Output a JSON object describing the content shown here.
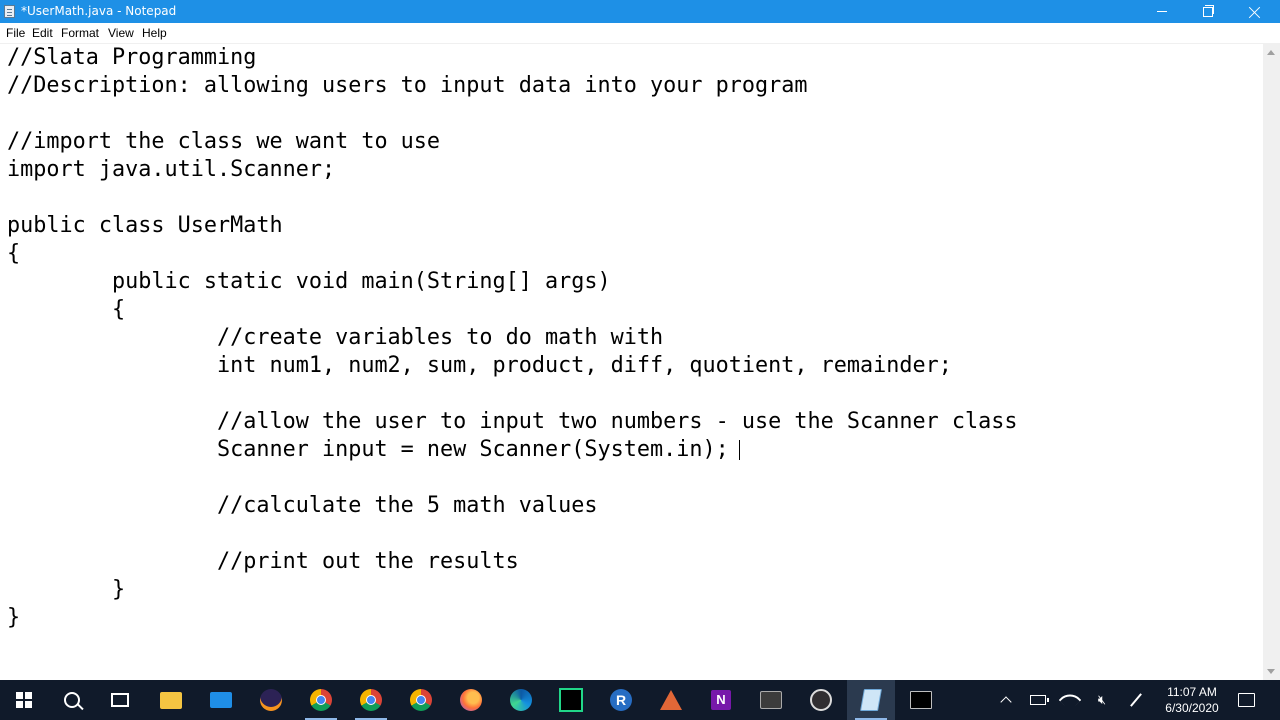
{
  "window": {
    "title": "*UserMath.java - Notepad"
  },
  "menu": [
    "File",
    "Edit",
    "Format",
    "View",
    "Help"
  ],
  "editor": {
    "lines": [
      "//Slata Programming",
      "//Description: allowing users to input data into your program",
      "",
      "//import the class we want to use",
      "import java.util.Scanner;",
      "",
      "public class UserMath",
      "{",
      "        public static void main(String[] args)",
      "        {",
      "                //create variables to do math with",
      "                int num1, num2, sum, product, diff, quotient, remainder;",
      "",
      "                //allow the user to input two numbers - use the Scanner class",
      "                Scanner input = new Scanner(System.in);",
      "",
      "                //calculate the 5 math values",
      "",
      "                //print out the results",
      "        }",
      "}"
    ]
  },
  "taskbar": {
    "apps": [
      {
        "icon": "windows-start-icon"
      },
      {
        "icon": "search-icon"
      },
      {
        "icon": "task-view-icon"
      },
      {
        "icon": "file-explorer-icon"
      },
      {
        "icon": "mail-icon"
      },
      {
        "icon": "eclipse-icon"
      },
      {
        "icon": "chrome-icon"
      },
      {
        "icon": "chrome-icon"
      },
      {
        "icon": "chrome-icon"
      },
      {
        "icon": "firefox-icon"
      },
      {
        "icon": "edge-icon"
      },
      {
        "icon": "pycharm-icon"
      },
      {
        "icon": "r-icon",
        "label": "R"
      },
      {
        "icon": "matlab-icon"
      },
      {
        "icon": "onenote-icon",
        "label": "N"
      },
      {
        "icon": "terminal-icon"
      },
      {
        "icon": "obs-icon"
      },
      {
        "icon": "notepad-icon"
      },
      {
        "icon": "cmd-icon"
      }
    ],
    "clock": {
      "time": "11:07 AM",
      "date": "6/30/2020"
    }
  },
  "colors": {
    "titlebar": "#1e90e6",
    "taskbar": "#101a2a",
    "editor_bg": "#ffffff"
  }
}
